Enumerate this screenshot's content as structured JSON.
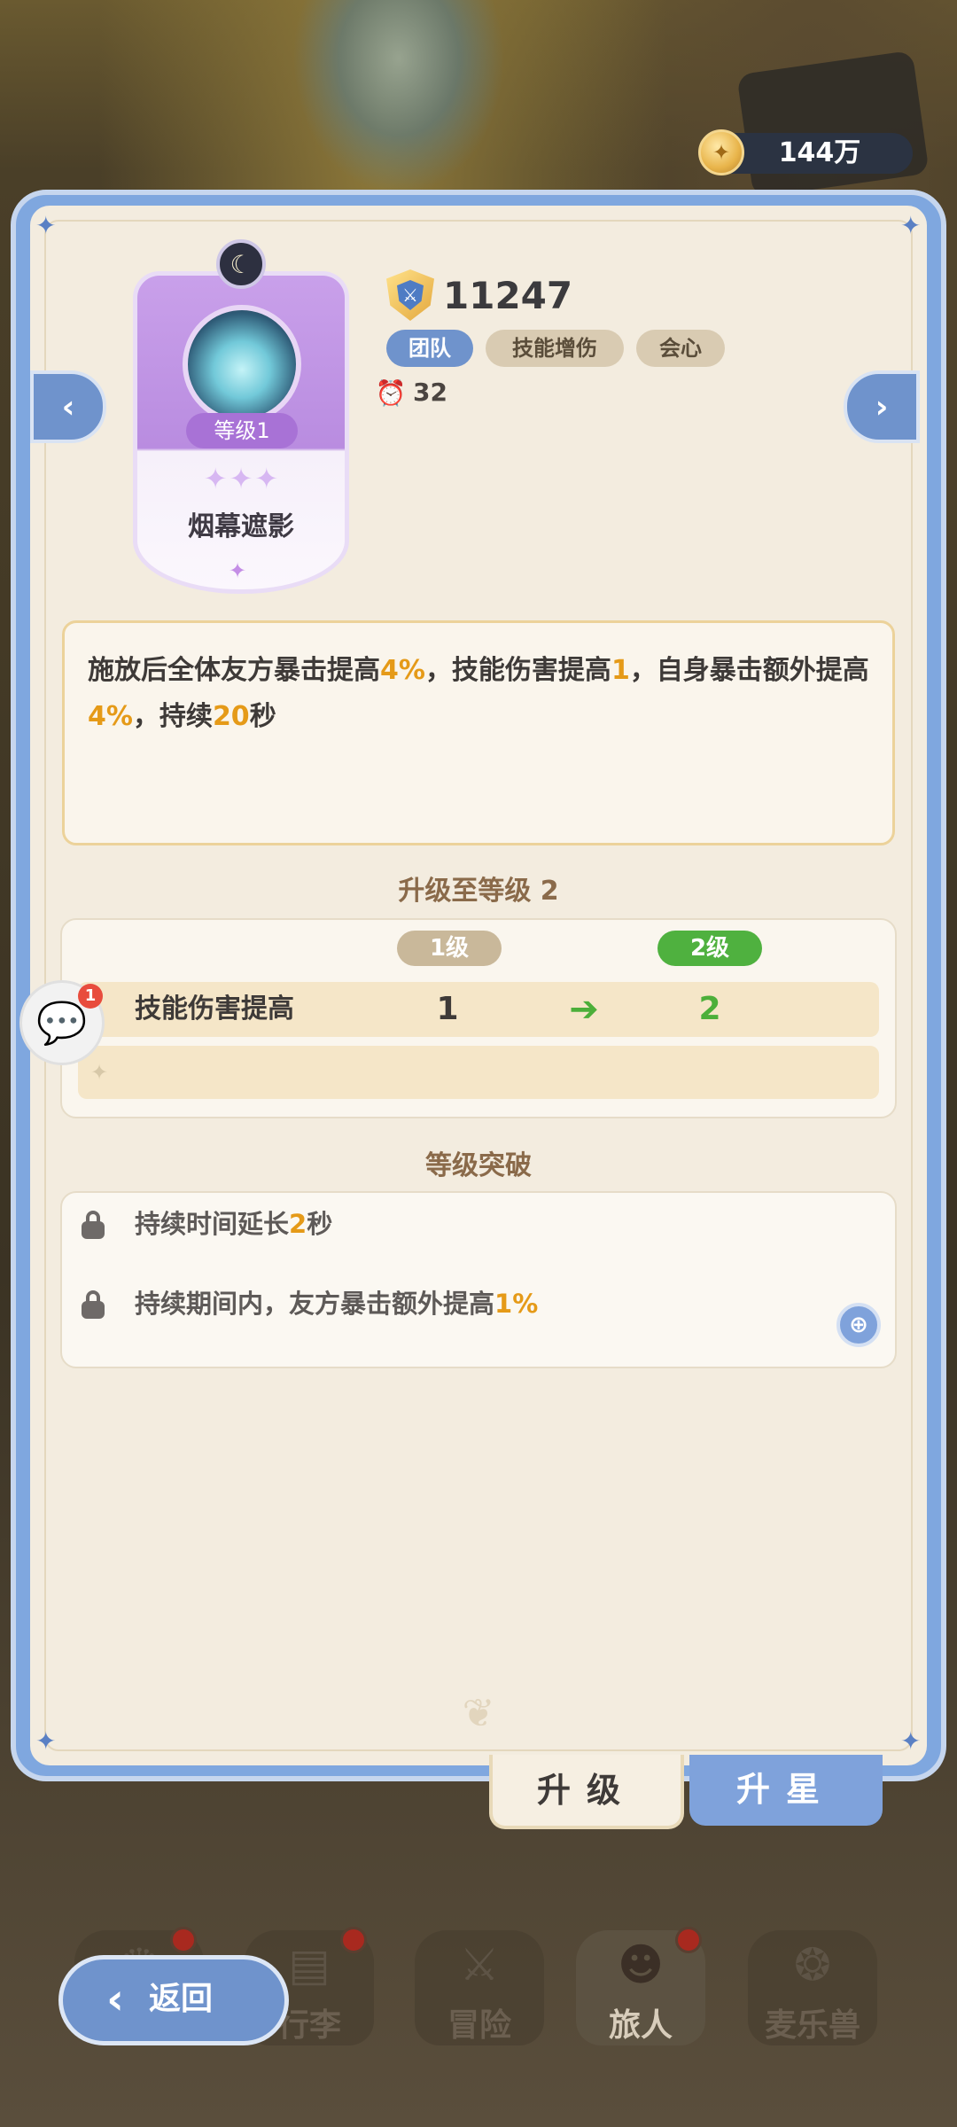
{
  "header": {
    "coins": "144万"
  },
  "skill": {
    "level_badge": "等级1",
    "stars": "✦✦✦",
    "name": "烟幕遮影",
    "power": "11247",
    "tags": [
      "团队",
      "技能增伤",
      "会心"
    ],
    "cooldown": "32"
  },
  "description": {
    "parts": [
      "施放后全体友方暴击提高",
      "4%",
      "，技能伤害提高",
      "1",
      "，自身暴击额外提高",
      "4%",
      "，持续",
      "20",
      "秒"
    ]
  },
  "upgrade": {
    "title": "升级至等级 2",
    "current_level": "1级",
    "next_level": "2级",
    "stat_label": "技能伤害提高",
    "current_value": "1",
    "next_value": "2"
  },
  "breakthrough": {
    "title": "等级突破",
    "items": [
      {
        "pre": "持续时间延长",
        "value": "2",
        "post": "秒"
      },
      {
        "pre": "持续期间内，友方暴击额外提高",
        "value": "1%",
        "post": ""
      }
    ]
  },
  "chat": {
    "badge": "1"
  },
  "tabs": {
    "upgrade": "升级",
    "star": "升星"
  },
  "bottom_nav": {
    "back": "返回",
    "items": [
      "行李",
      "冒险",
      "旅人",
      "麦乐兽"
    ]
  }
}
